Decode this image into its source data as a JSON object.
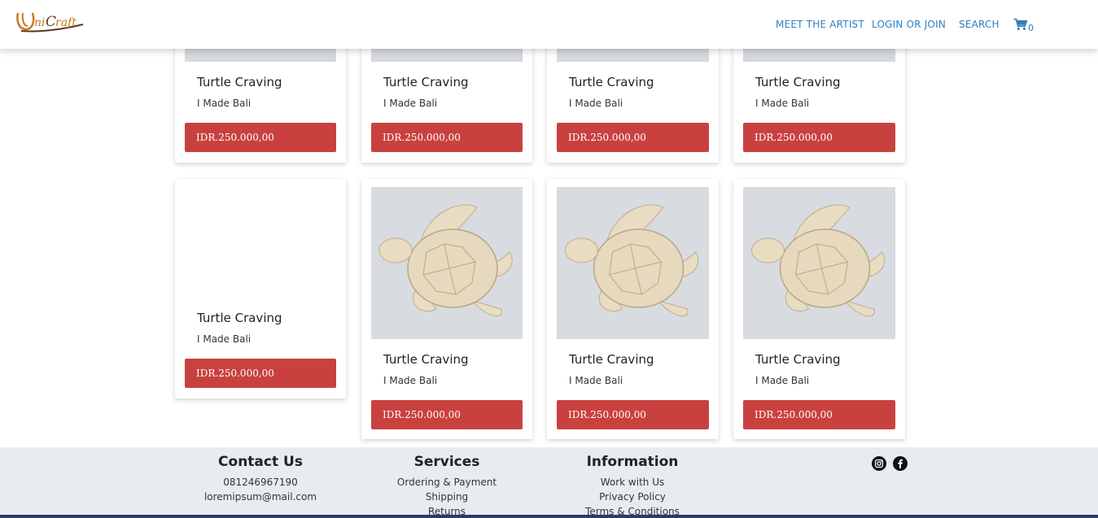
{
  "header": {
    "logo_text": "UniCraft",
    "nav": {
      "meet_artist": "MEET THE ARTIST",
      "login": "LOGIN OR JOIN",
      "search": "SEARCH"
    },
    "cart_count": "0"
  },
  "products": [
    {
      "title": "Turtle Craving",
      "artist": "I Made Bali",
      "price": "IDR.250.000,00"
    },
    {
      "title": "Turtle Craving",
      "artist": "I Made Bali",
      "price": "IDR.250.000,00"
    },
    {
      "title": "Turtle Craving",
      "artist": "I Made Bali",
      "price": "IDR.250.000,00"
    },
    {
      "title": "Turtle Craving",
      "artist": "I Made Bali",
      "price": "IDR.250.000,00"
    },
    {
      "title": "Turtle Craving",
      "artist": "I Made Bali",
      "price": "IDR.250.000,00"
    },
    {
      "title": "Turtle Craving",
      "artist": "I Made Bali",
      "price": "IDR.250.000,00"
    },
    {
      "title": "Turtle Craving",
      "artist": "I Made Bali",
      "price": "IDR.250.000,00"
    },
    {
      "title": "Turtle Craving",
      "artist": "I Made Bali",
      "price": "IDR.250.000,00"
    }
  ],
  "footer": {
    "contact": {
      "heading": "Contact Us",
      "phone": "081246967190",
      "email": "loremipsum@mail.com"
    },
    "services": {
      "heading": "Services",
      "items": [
        "Ordering & Payment",
        "Shipping",
        "Returns"
      ]
    },
    "information": {
      "heading": "Information",
      "items": [
        "Work with Us",
        "Privacy Policy",
        "Terms & Conditions"
      ]
    },
    "social": [
      "instagram-icon",
      "facebook-icon"
    ]
  },
  "colors": {
    "accent_link": "#2f7fc1",
    "price_bar": "#c9413f",
    "footer_bg": "#e9ecee"
  }
}
